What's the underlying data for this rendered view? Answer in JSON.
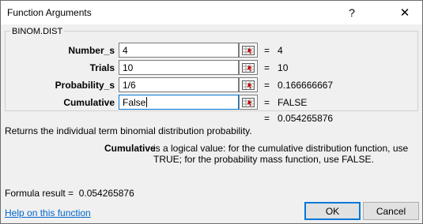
{
  "window": {
    "title": "Function Arguments",
    "help_glyph": "?",
    "close_glyph": "✕"
  },
  "function_name": "BINOM.DIST",
  "arguments": [
    {
      "label": "Number_s",
      "input": "4",
      "value": "4"
    },
    {
      "label": "Trials",
      "input": "10",
      "value": "10"
    },
    {
      "label": "Probability_s",
      "input": "1/6",
      "value": "0.166666667"
    },
    {
      "label": "Cumulative",
      "input": "False",
      "value": "FALSE"
    }
  ],
  "equals_sign": "=",
  "result_value": "0.054265876",
  "description": "Returns the individual term binomial distribution probability.",
  "argument_help": {
    "name": "Cumulative",
    "text": "is a logical value: for the cumulative distribution function, use TRUE; for the probability mass function, use FALSE."
  },
  "formula_result": {
    "label": "Formula result =",
    "value": "0.054265876"
  },
  "help_link": "Help on this function",
  "buttons": {
    "ok": "OK",
    "cancel": "Cancel"
  },
  "colors": {
    "accent": "#0078d7",
    "link": "#0066cc",
    "dialog_bg": "#f0f0f0"
  }
}
